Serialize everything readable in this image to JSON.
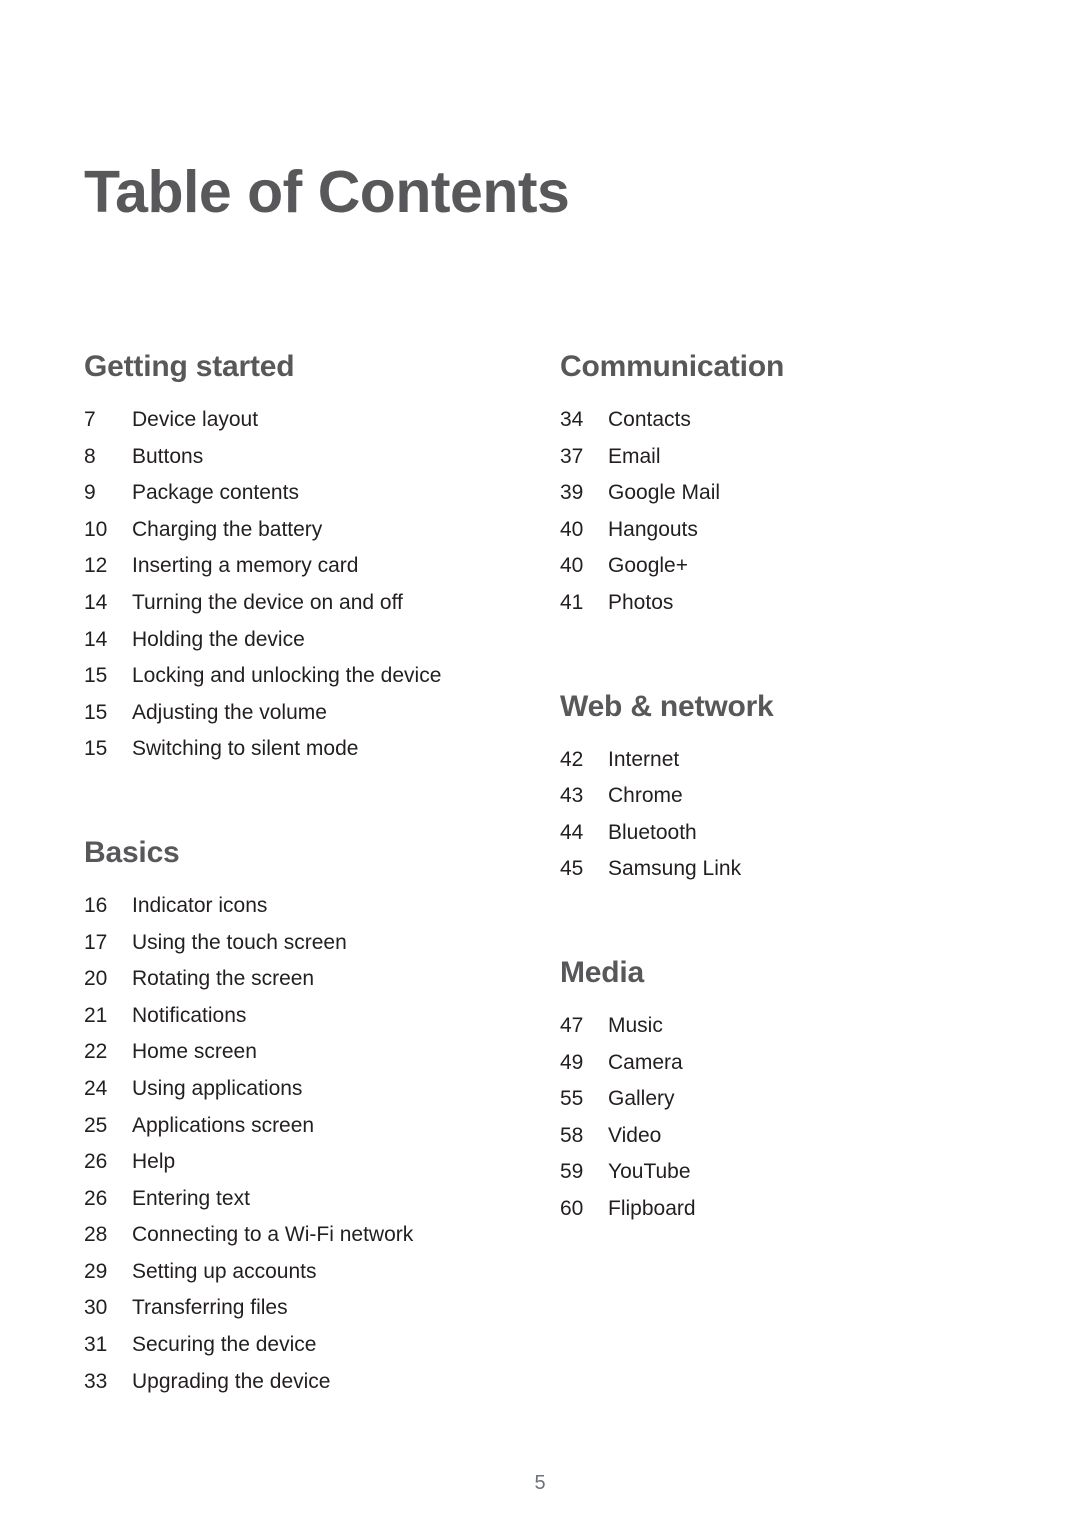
{
  "document": {
    "title": "Table of Contents",
    "page_number": "5"
  },
  "colors": {
    "heading": "#58585B",
    "body": "#231F20",
    "folio": "#6D7278",
    "background": "#FFFFFF"
  },
  "columns": [
    {
      "name": "left",
      "sections": [
        {
          "heading": "Getting started",
          "entries": [
            {
              "page": "7",
              "label": "Device layout"
            },
            {
              "page": "8",
              "label": "Buttons"
            },
            {
              "page": "9",
              "label": "Package contents"
            },
            {
              "page": "10",
              "label": "Charging the battery"
            },
            {
              "page": "12",
              "label": "Inserting a memory card"
            },
            {
              "page": "14",
              "label": "Turning the device on and off"
            },
            {
              "page": "14",
              "label": "Holding the device"
            },
            {
              "page": "15",
              "label": "Locking and unlocking the device"
            },
            {
              "page": "15",
              "label": "Adjusting the volume"
            },
            {
              "page": "15",
              "label": "Switching to silent mode"
            }
          ]
        },
        {
          "heading": "Basics",
          "entries": [
            {
              "page": "16",
              "label": "Indicator icons"
            },
            {
              "page": "17",
              "label": "Using the touch screen"
            },
            {
              "page": "20",
              "label": "Rotating the screen"
            },
            {
              "page": "21",
              "label": "Notifications"
            },
            {
              "page": "22",
              "label": "Home screen"
            },
            {
              "page": "24",
              "label": "Using applications"
            },
            {
              "page": "25",
              "label": "Applications screen"
            },
            {
              "page": "26",
              "label": "Help"
            },
            {
              "page": "26",
              "label": "Entering text"
            },
            {
              "page": "28",
              "label": "Connecting to a Wi-Fi network"
            },
            {
              "page": "29",
              "label": "Setting up accounts"
            },
            {
              "page": "30",
              "label": "Transferring files"
            },
            {
              "page": "31",
              "label": "Securing the device"
            },
            {
              "page": "33",
              "label": "Upgrading the device"
            }
          ]
        }
      ]
    },
    {
      "name": "right",
      "sections": [
        {
          "heading": "Communication",
          "entries": [
            {
              "page": "34",
              "label": "Contacts"
            },
            {
              "page": "37",
              "label": "Email"
            },
            {
              "page": "39",
              "label": "Google Mail"
            },
            {
              "page": "40",
              "label": "Hangouts"
            },
            {
              "page": "40",
              "label": "Google+"
            },
            {
              "page": "41",
              "label": "Photos"
            }
          ]
        },
        {
          "heading": "Web & network",
          "entries": [
            {
              "page": "42",
              "label": "Internet"
            },
            {
              "page": "43",
              "label": "Chrome"
            },
            {
              "page": "44",
              "label": "Bluetooth"
            },
            {
              "page": "45",
              "label": "Samsung Link"
            }
          ]
        },
        {
          "heading": "Media",
          "entries": [
            {
              "page": "47",
              "label": "Music"
            },
            {
              "page": "49",
              "label": "Camera"
            },
            {
              "page": "55",
              "label": "Gallery"
            },
            {
              "page": "58",
              "label": "Video"
            },
            {
              "page": "59",
              "label": "YouTube"
            },
            {
              "page": "60",
              "label": "Flipboard"
            }
          ]
        }
      ]
    }
  ]
}
